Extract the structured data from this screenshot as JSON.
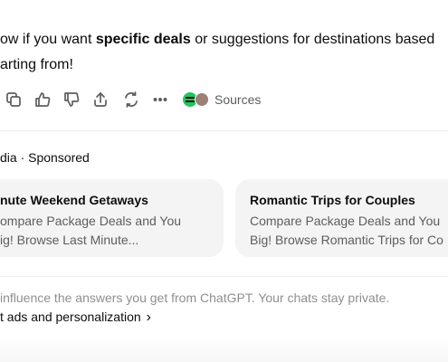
{
  "message": {
    "line1_prefix": "ow if you want ",
    "line1_bold": "specific deals",
    "line1_suffix": " or suggestions for destinations based",
    "line2": "arting from!"
  },
  "actions": {
    "icons": [
      "copy-icon",
      "thumbs-up-icon",
      "thumbs-down-icon",
      "share-icon",
      "regenerate-icon",
      "more-icon"
    ],
    "sources_label": "Sources",
    "colors": {
      "icon": "#5d5d5d",
      "source_green": "#22c55e",
      "source_avatar": "#9b8077"
    }
  },
  "sponsored": {
    "label": "dia · Sponsored",
    "cards": [
      {
        "title": "nute Weekend Getaways",
        "desc_line1": "ompare Package Deals and You",
        "desc_line2": "ig! Browse Last Minute..."
      },
      {
        "title": "Romantic Trips for Couples",
        "desc_line1": "Compare Package Deals and You",
        "desc_line2": "Big! Browse Romantic Trips for Co"
      }
    ]
  },
  "footer": {
    "notice": " influence the answers you get from ChatGPT. Your chats stay private.",
    "link": "t ads and personalization",
    "link_chevron": "›"
  }
}
